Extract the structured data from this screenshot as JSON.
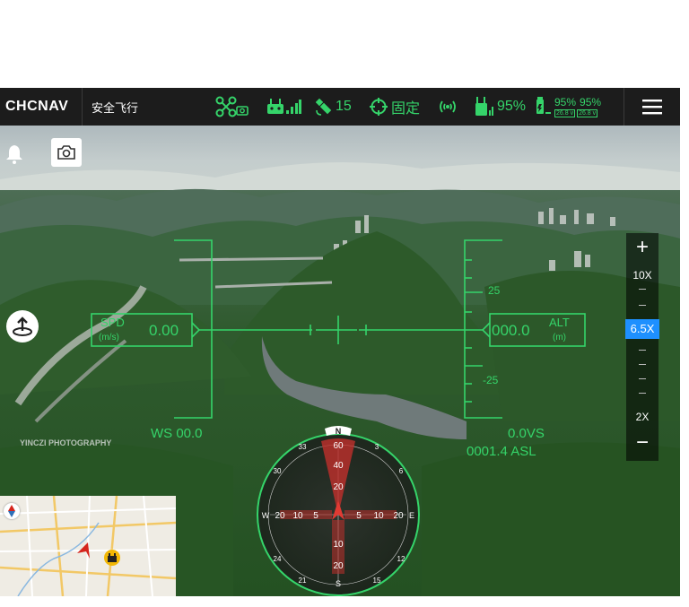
{
  "topbar": {
    "brand": "CHCNAV",
    "mode": "安全飞行",
    "satellites": "15",
    "positioning": "固定",
    "rc_battery": "95%",
    "drone_battery_a": "95%",
    "drone_battery_b": "95%",
    "voltage_a": "26.8 v",
    "voltage_b": "26.8 v"
  },
  "hud": {
    "spd_label": "SPD",
    "spd_unit": "(m/s)",
    "spd_value": "0.00",
    "alt_label": "ALT",
    "alt_unit": "(m)",
    "alt_value": "000.0",
    "ws": "WS 00.0",
    "vs": "0.0VS",
    "asl": "0001.4 ASL",
    "alt_tick_plus": "25",
    "alt_tick_minus": "-25"
  },
  "compass": {
    "n": "N",
    "s": "S",
    "e": "E",
    "w": "W",
    "labels_top": [
      "60",
      "40",
      "20"
    ],
    "labels_bottom": [
      "10",
      "20"
    ],
    "labels_left": [
      "20",
      "10",
      "5"
    ],
    "labels_right": [
      "5",
      "10",
      "20"
    ],
    "outer": [
      "33",
      "30",
      "3",
      "6",
      "12",
      "15",
      "21",
      "24"
    ]
  },
  "zoom": {
    "plus": "+",
    "minus": "−",
    "max_label": "10X",
    "current": "6.5X",
    "min_label": "2X"
  },
  "watermark": "YINCZI PHOTOGRAPHY",
  "colors": {
    "hud": "#35d46a",
    "accent": "#1e90ff",
    "bar": "#1c1c1c"
  },
  "icons": [
    "drone-camera-icon",
    "remote-controller-icon",
    "satellite-icon",
    "rtk-target-icon",
    "signal-icon",
    "rc-battery-icon",
    "drone-battery-icon",
    "menu-icon",
    "bell-icon",
    "camera-icon",
    "return-home-icon",
    "compass-icon",
    "home-marker-icon"
  ]
}
